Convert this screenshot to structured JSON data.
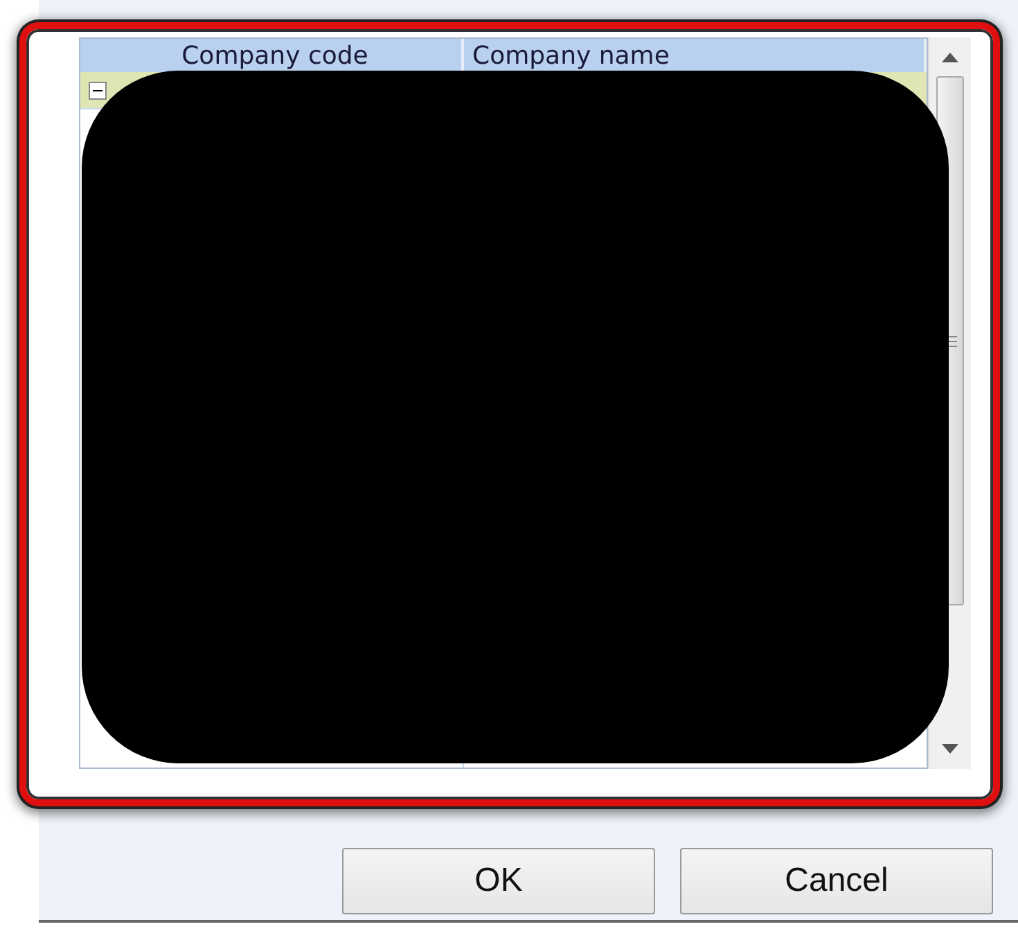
{
  "grid": {
    "columns": [
      "Company code",
      "Company name"
    ],
    "rows": [
      {
        "kind": "group",
        "expanded": true
      }
    ]
  },
  "buttons": [
    "OK",
    "Cancel"
  ]
}
